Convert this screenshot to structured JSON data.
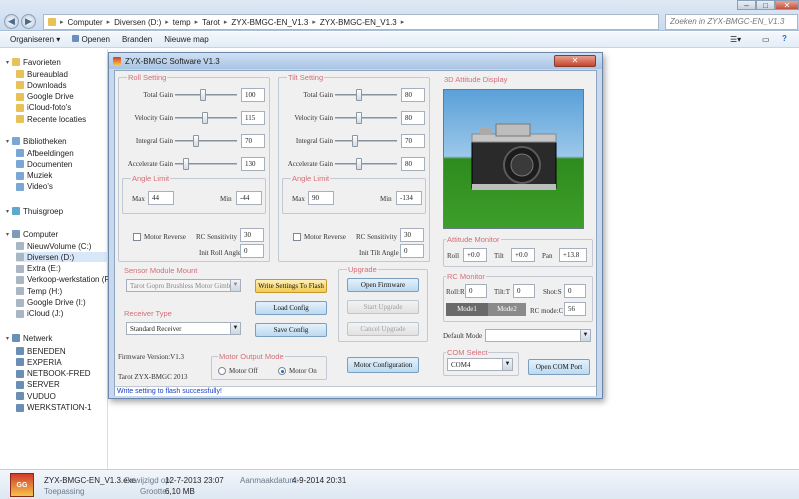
{
  "explorer": {
    "address": [
      "Computer",
      "Diversen (D:)",
      "temp",
      "Tarot",
      "ZYX-BMGC-EN_V1.3",
      "ZYX-BMGC-EN_V1.3"
    ],
    "search_placeholder": "Zoeken in ZYX-BMGC-EN_V1.3",
    "toolbar": [
      "Organiseren ▾",
      "Openen",
      "Branden",
      "Nieuwe map"
    ],
    "favorites_label": "Favorieten",
    "favorites": [
      "Bureaublad",
      "Downloads",
      "Google Drive",
      "iCloud-foto's",
      "Recente locaties"
    ],
    "libraries_label": "Bibliotheken",
    "libraries": [
      "Afbeeldingen",
      "Documenten",
      "Muziek",
      "Video's"
    ],
    "homegroup_label": "Thuisgroep",
    "computer_label": "Computer",
    "drives": [
      "NieuwVolume (C:)",
      "Diversen (D:)",
      "Extra (E:)",
      "Verkoop-werkstation (F:)",
      "Temp (H:)",
      "Google Drive (I:)",
      "iCloud (J:)"
    ],
    "network_label": "Netwerk",
    "network": [
      "BENEDEN",
      "EXPERIA",
      "NETBOOK-FRED",
      "SERVER",
      "VUDUO",
      "WERKSTATION-1"
    ],
    "file": {
      "name": "ZYX-BMGC-EN_V1.3.exe",
      "modified_label": "Gewijzigd op:",
      "modified": "12-7-2013 23:07",
      "created_label": "Aanmaakdatum:",
      "created": "4-9-2014 20:31",
      "type": "Toepassing",
      "size_label": "Grootte:",
      "size": "6,10 MB"
    }
  },
  "app": {
    "title": "ZYX-BMGC Software V1.3",
    "roll": {
      "title": "Roll Setting",
      "rows": [
        {
          "label": "Total Gain",
          "value": "100",
          "level": 0.45
        },
        {
          "label": "Velocity Gain",
          "value": "115",
          "level": 0.48
        },
        {
          "label": "Integral Gain",
          "value": "70",
          "level": 0.32
        },
        {
          "label": "Accelerate Gain",
          "value": "130",
          "level": 0.15
        }
      ],
      "angle_title": "Angle Limit",
      "max_label": "Max",
      "max_value": "44",
      "min_label": "Min",
      "min_value": "-44",
      "reverse_label": "Motor Reverse",
      "rc_sens_label": "RC Sensitivity",
      "rc_sens_value": "30",
      "init_label": "Init Roll Angle",
      "init_value": "0"
    },
    "tilt": {
      "title": "Tilt Setting",
      "rows": [
        {
          "label": "Total Gain",
          "value": "80",
          "level": 0.38
        },
        {
          "label": "Velocity Gain",
          "value": "80",
          "level": 0.38
        },
        {
          "label": "Integral Gain",
          "value": "70",
          "level": 0.3
        },
        {
          "label": "Accelerate Gain",
          "value": "80",
          "level": 0.38
        }
      ],
      "angle_title": "Angle Limit",
      "max_label": "Max",
      "max_value": "90",
      "min_label": "Min",
      "min_value": "-134",
      "reverse_label": "Motor Reverse",
      "rc_sens_label": "RC Sensitivity",
      "rc_sens_value": "30",
      "init_label": "Init Tilt Angle",
      "init_value": "0"
    },
    "display_title": "3D Attitude Display",
    "attitude": {
      "title": "Attitude Monitor",
      "roll_label": "Roll",
      "roll_value": "+0.0",
      "tilt_label": "Tilt",
      "tilt_value": "+0.0",
      "pan_label": "Pan",
      "pan_value": "+13.8"
    },
    "rc": {
      "title": "RC Monitor",
      "roll_label": "Roll:R",
      "roll_value": "0",
      "tilt_label": "Tilt:T",
      "tilt_value": "0",
      "shot_label": "Shot:S",
      "shot_value": "0",
      "mode1": "Mode1",
      "mode2": "Mode2",
      "rcmode_label": "RC mode:C",
      "rcmode_value": "56"
    },
    "default_mode_label": "Default Mode",
    "com": {
      "title": "COM Select",
      "port": "COM4",
      "open_button": "Open COM Port"
    },
    "sensor": {
      "title": "Sensor Module Mount",
      "value": "Tarot Gopro Brushless Motor Gimbal"
    },
    "receiver": {
      "title": "Receiver Type",
      "value": "Standard Receiver"
    },
    "buttons": {
      "write": "Write Settings To Flash",
      "load": "Load Config",
      "save": "Save Config",
      "motor_config": "Motor Configuration"
    },
    "upgrade": {
      "title": "Upgrade",
      "open_fw": "Open Firmware",
      "start": "Start Upgrade",
      "cancel": "Cancel Upgrade"
    },
    "firmware": "Firmware Version:V1.3",
    "copyright": "Tarot ZYX-BMGC 2013",
    "motor_mode": {
      "title": "Motor Output Mode",
      "off": "Motor Off",
      "on": "Motor On"
    },
    "status": "Write setting to flash successfully!"
  },
  "colors": {
    "group_title": "#d26e7a",
    "status_text": "#1a3fc4",
    "grass": "#2e8b1e",
    "sky": "#5aa0d8"
  }
}
